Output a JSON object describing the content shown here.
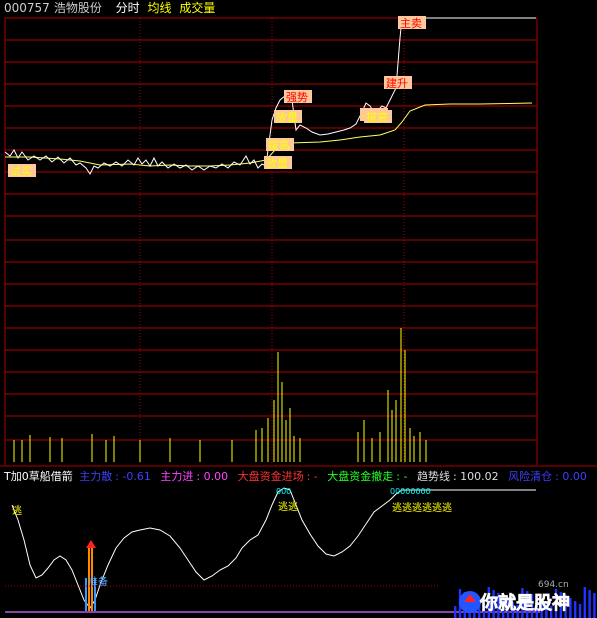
{
  "header": {
    "code": "000757",
    "name": "浩物股份",
    "mode": "分时",
    "avg_line": "均线",
    "volume": "成交量"
  },
  "colors": {
    "grid_red": "#b00000",
    "price_line": "#ffffff",
    "avg_line": "#ffff66",
    "volume_bar": "#ffff00",
    "tag_bg": "#ffc89a",
    "tag_red": "#ff0000"
  },
  "signals": [
    {
      "text": "试买",
      "color": "#ffff00"
    },
    {
      "text": "放量",
      "color": "#ffff00"
    },
    {
      "text": "放量",
      "color": "#ffff00"
    },
    {
      "text": "强势",
      "color": "#ff0000"
    },
    {
      "text": "拔高",
      "color": "#ffff00"
    },
    {
      "text": "拔高",
      "color": "#ffff00"
    },
    {
      "text": "拔高",
      "color": "#ffff00"
    },
    {
      "text": "建升",
      "color": "#ff0000"
    },
    {
      "text": "主卖",
      "color": "#ff0000"
    }
  ],
  "indicator": {
    "name": "T加0草船借箭",
    "fields": [
      {
        "label": "主力散",
        "value": "-0.61",
        "color": "#3f3fff"
      },
      {
        "label": "主力进",
        "value": "0.00",
        "color": "#ff44ff"
      },
      {
        "label": "大盘资金进场",
        "value": "-",
        "color": "#ff3030"
      },
      {
        "label": "大盘资金撤走",
        "value": "-",
        "color": "#22ff22"
      },
      {
        "label": "趋势线",
        "value": "100.02",
        "color": "#dddddd"
      },
      {
        "label": "风险清仓",
        "value": "0.00",
        "color": "#3f3fff"
      }
    ],
    "marks": [
      {
        "text": "逃",
        "color": "#ffff00"
      },
      {
        "text": "逃逃",
        "color": "#ffff00"
      },
      {
        "text": "逃逃逃逃逃逃",
        "color": "#ffff00"
      },
      {
        "text": "准备",
        "color": "#55aaff"
      },
      {
        "text": "000",
        "color": "#00ffff"
      },
      {
        "text": "00000000",
        "color": "#00ffff"
      }
    ]
  },
  "watermark": {
    "site": "694.cn",
    "text": "你就是股神"
  }
}
